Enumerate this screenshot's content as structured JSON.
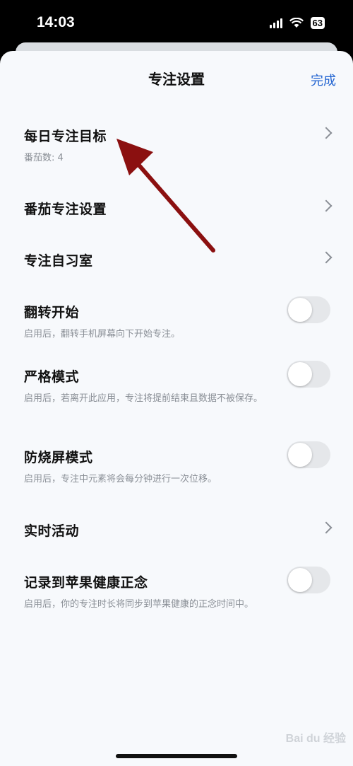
{
  "status_bar": {
    "time": "14:03",
    "battery": "63"
  },
  "header": {
    "title": "专注设置",
    "done_label": "完成"
  },
  "settings": [
    {
      "title": "每日专注目标",
      "subtitle": "番茄数: 4",
      "control": "chevron"
    },
    {
      "title": "番茄专注设置",
      "subtitle": "",
      "control": "chevron"
    },
    {
      "title": "专注自习室",
      "subtitle": "",
      "control": "chevron"
    },
    {
      "title": "翻转开始",
      "subtitle": "启用后，翻转手机屏幕向下开始专注。",
      "control": "toggle",
      "on": false
    },
    {
      "title": "严格模式",
      "subtitle": "启用后，若离开此应用，专注将提前结束且数据不被保存。",
      "control": "toggle",
      "on": false
    },
    {
      "title": "防烧屏模式",
      "subtitle": "启用后，专注中元素将会每分钟进行一次位移。",
      "control": "toggle",
      "on": false
    },
    {
      "title": "实时活动",
      "subtitle": "",
      "control": "chevron"
    },
    {
      "title": "记录到苹果健康正念",
      "subtitle": "启用后，你的专注时长将同步到苹果健康的正念时间中。",
      "control": "toggle",
      "on": false
    }
  ],
  "watermark": "Bai du 经验",
  "colors": {
    "accent": "#2264d1",
    "arrow": "#8b1010",
    "toggle_off": "#e5e7ea"
  }
}
